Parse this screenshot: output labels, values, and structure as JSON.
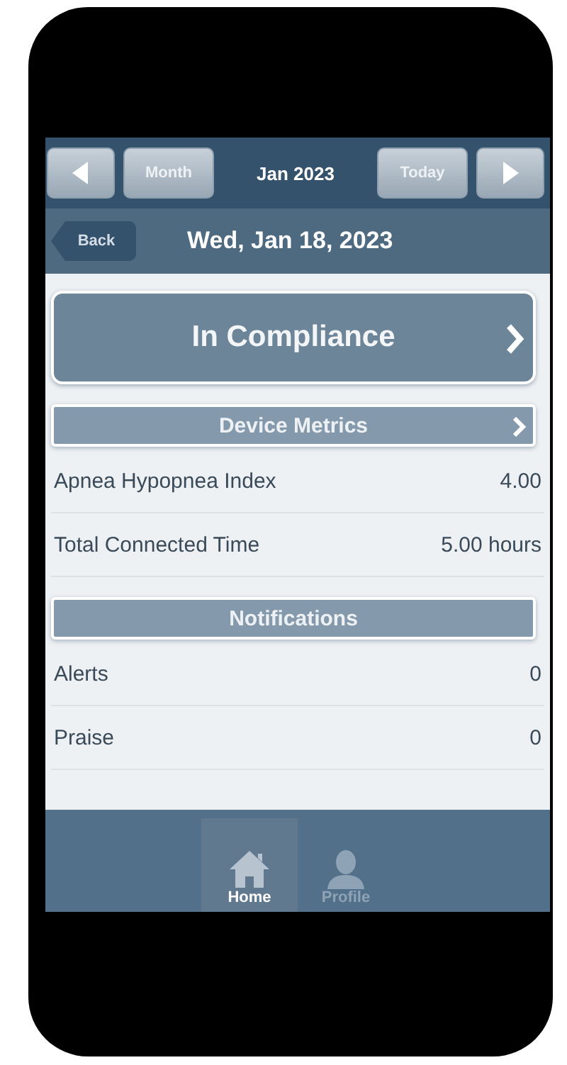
{
  "nav": {
    "month_button": "Month",
    "title": "Jan 2023",
    "today_button": "Today"
  },
  "date_bar": {
    "back": "Back",
    "title": "Wed, Jan 18, 2023"
  },
  "status_button": {
    "label": "In Compliance"
  },
  "sections": [
    {
      "title": "Device Metrics",
      "chevron": true,
      "rows": [
        {
          "label": "Apnea Hypopnea Index",
          "value": "4.00"
        },
        {
          "label": "Total Connected Time",
          "value": "5.00 hours"
        }
      ]
    },
    {
      "title": "Notifications",
      "chevron": false,
      "rows": [
        {
          "label": "Alerts",
          "value": "0"
        },
        {
          "label": "Praise",
          "value": "0"
        }
      ]
    }
  ],
  "tab_bar": [
    {
      "label": "Home",
      "kind": "home",
      "selected": true
    },
    {
      "label": "Profile",
      "kind": "person",
      "selected": false
    }
  ]
}
